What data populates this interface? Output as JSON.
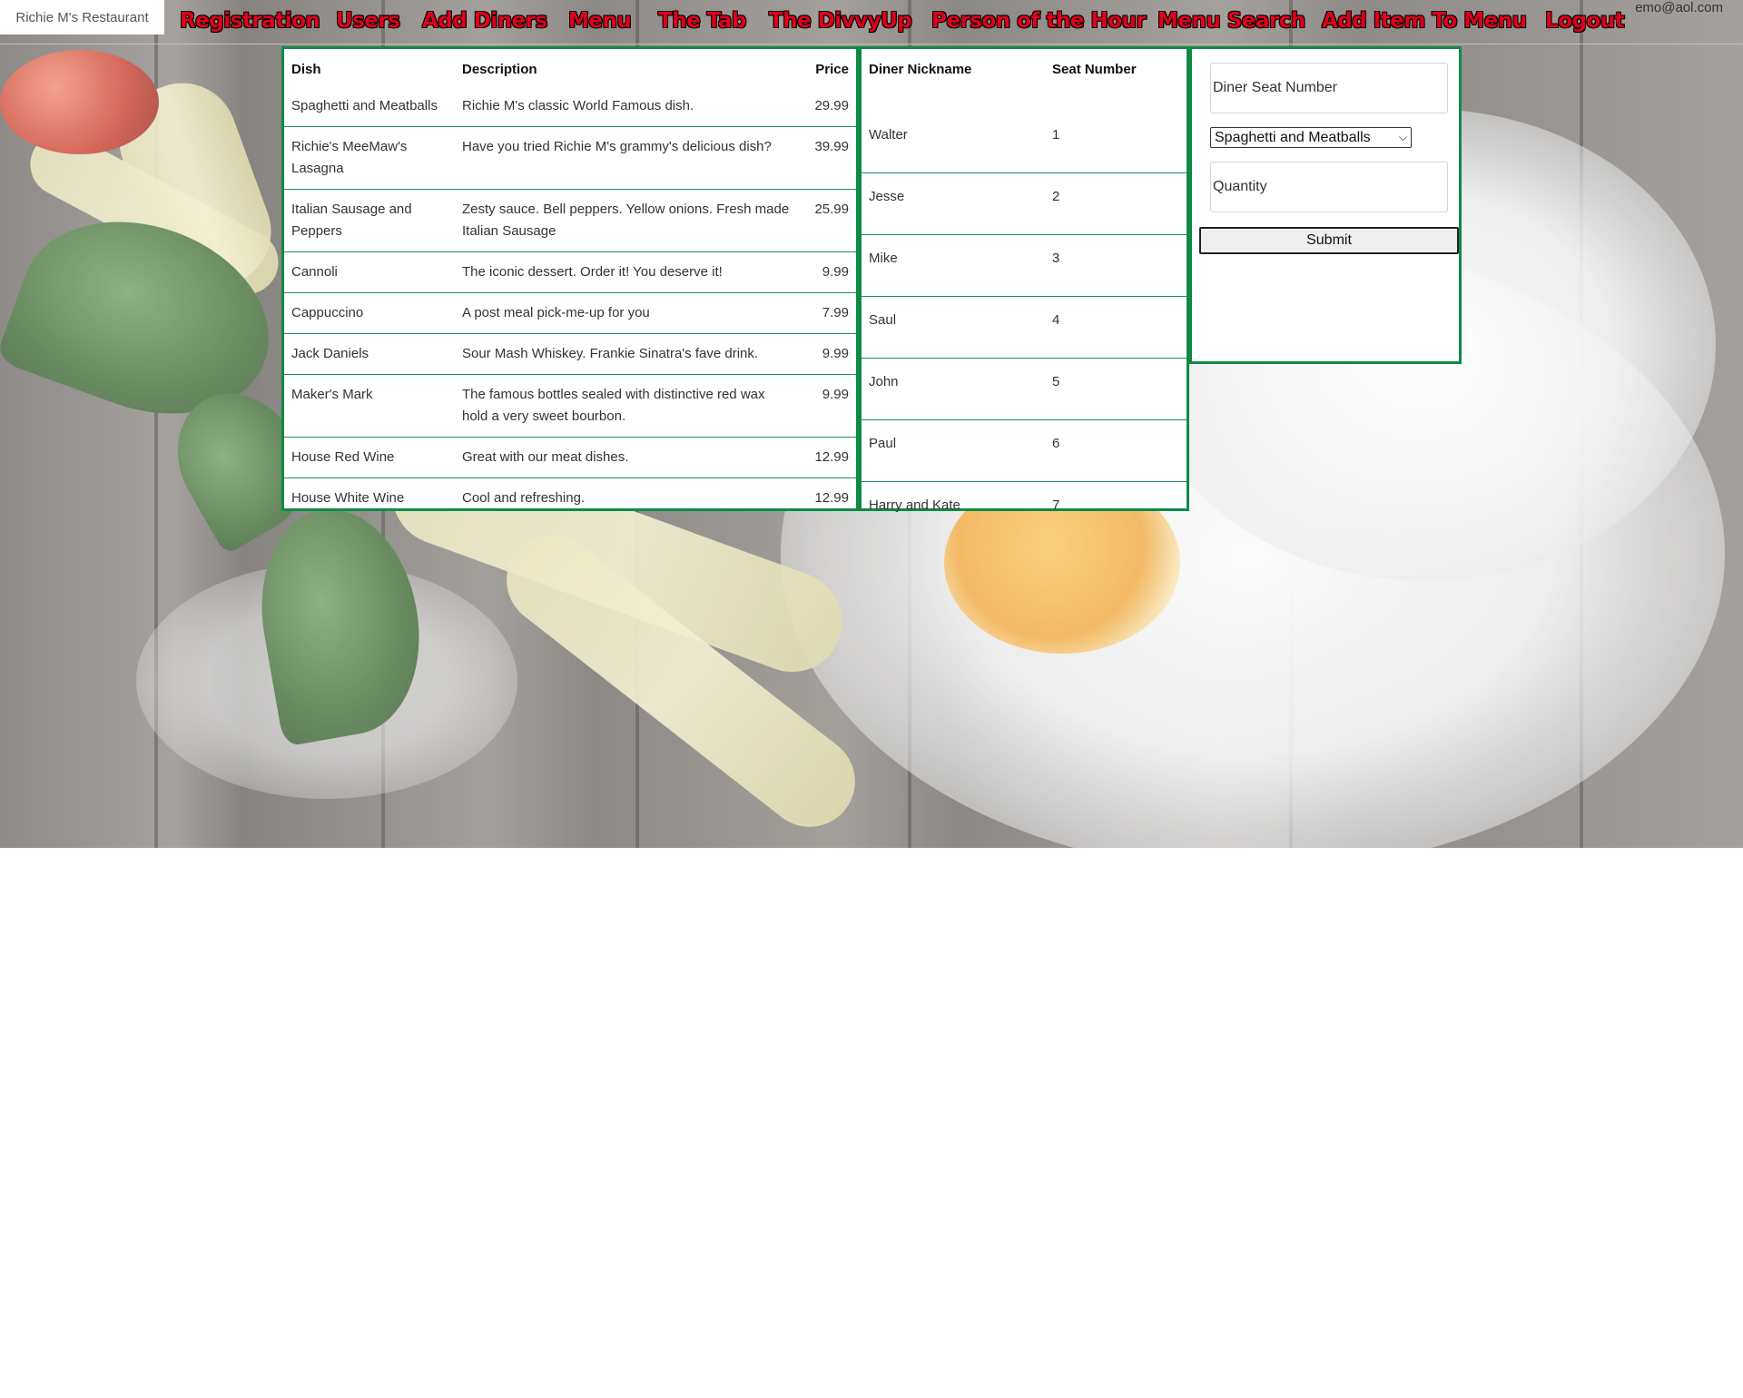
{
  "brand": "Richie M's Restaurant",
  "user_email": "emo@aol.com",
  "nav": [
    {
      "label": "Registration"
    },
    {
      "label": "Users"
    },
    {
      "label": "Add Diners"
    },
    {
      "label": "Menu"
    },
    {
      "label": "The Tab"
    },
    {
      "label": "The DivvyUp"
    },
    {
      "label": "Person of the Hour"
    },
    {
      "label": "Menu Search"
    },
    {
      "label": "Add Item To Menu"
    },
    {
      "label": "Logout"
    }
  ],
  "menu_table": {
    "headers": {
      "dish": "Dish",
      "description": "Description",
      "price": "Price"
    },
    "rows": [
      {
        "dish": "Spaghetti and Meatballs",
        "description": "Richie M's classic World Famous dish.",
        "price": "29.99"
      },
      {
        "dish": "Richie's MeeMaw's Lasagna",
        "description": "Have you tried Richie M's grammy's delicious dish?",
        "price": "39.99"
      },
      {
        "dish": "Italian Sausage and Peppers",
        "description": "Zesty sauce. Bell peppers. Yellow onions. Fresh made Italian Sausage",
        "price": "25.99"
      },
      {
        "dish": "Cannoli",
        "description": "The iconic dessert. Order it! You deserve it!",
        "price": "9.99"
      },
      {
        "dish": "Cappuccino",
        "description": "A post meal pick-me-up for you",
        "price": "7.99"
      },
      {
        "dish": "Jack Daniels",
        "description": "Sour Mash Whiskey. Frankie Sinatra's fave drink.",
        "price": "9.99"
      },
      {
        "dish": "Maker's Mark",
        "description": "The famous bottles sealed with distinctive red wax hold a very sweet bourbon.",
        "price": "9.99"
      },
      {
        "dish": "House Red Wine",
        "description": "Great with our meat dishes.",
        "price": "12.99"
      },
      {
        "dish": "House White Wine",
        "description": "Cool and refreshing.",
        "price": "12.99"
      }
    ]
  },
  "diner_table": {
    "headers": {
      "nickname": "Diner Nickname",
      "seat": "Seat Number"
    },
    "rows": [
      {
        "nickname": "Walter",
        "seat": "1"
      },
      {
        "nickname": "Jesse",
        "seat": "2"
      },
      {
        "nickname": "Mike",
        "seat": "3"
      },
      {
        "nickname": "Saul",
        "seat": "4"
      },
      {
        "nickname": "John",
        "seat": "5"
      },
      {
        "nickname": "Paul",
        "seat": "6"
      },
      {
        "nickname": "Harry and Kate",
        "seat": "7"
      }
    ]
  },
  "order_form": {
    "seat_placeholder": "Diner Seat Number",
    "dish_selected": "Spaghetti and Meatballs",
    "quantity_placeholder": "Quantity",
    "submit_label": "Submit"
  },
  "colors": {
    "nav_link": "#e0001a",
    "panel_border": "#0f8a46"
  }
}
